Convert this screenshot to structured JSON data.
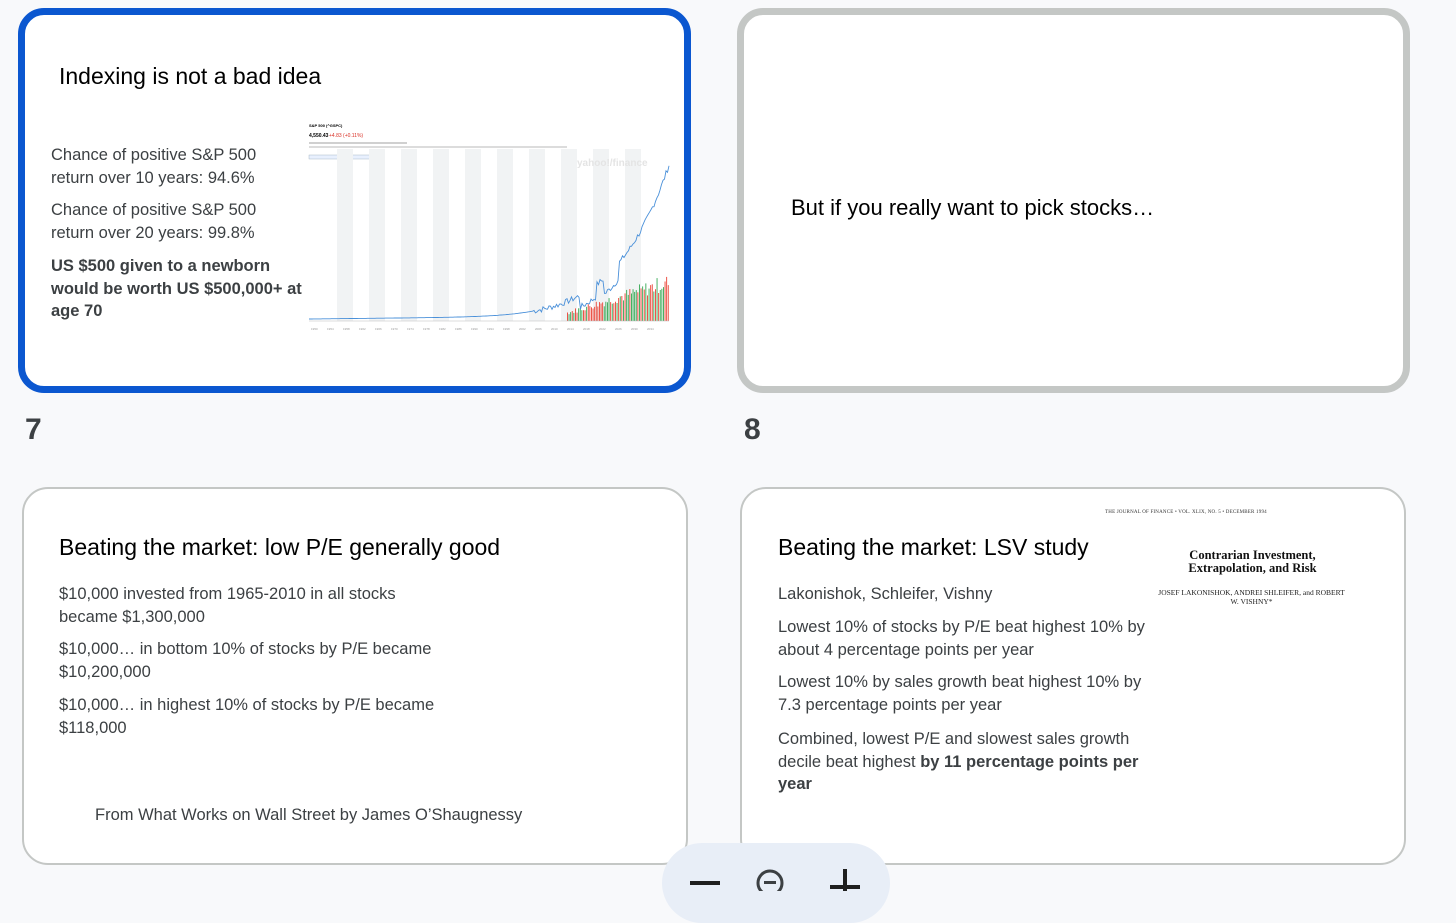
{
  "slides": [
    {
      "number": "",
      "state": "selected",
      "title": "Indexing is not a bad idea",
      "bullets": [
        "Chance of positive S&P 500 return over 10 years: 94.6%",
        "Chance of positive S&P 500 return over 20 years: 99.8%",
        "US $500 given to a newborn would be worth US $500,000+ at age 70"
      ],
      "chart_image": {
        "ticker": "S&P 500 (^GSPC)",
        "price": "4,550.43",
        "change": "+4.83 (+0.11%)",
        "watermark": "yahoo!/finance"
      }
    },
    {
      "number": "",
      "state": "hovered",
      "title": "But if you really want to pick stocks…"
    },
    {
      "number": "7",
      "title": "Beating the market: low P/E generally good",
      "bullets": [
        "$10,000 invested from 1965-2010 in all stocks became $1,300,000",
        "$10,000…  in bottom 10% of stocks by P/E became $10,200,000",
        "$10,000… in highest 10% of stocks by P/E became $118,000"
      ],
      "footer": "From What Works on Wall Street by James O’Shaugnessy"
    },
    {
      "number": "8",
      "title": "Beating the market: LSV study",
      "bullets": [
        "Lakonishok, Schleifer, Vishny",
        "Lowest 10% of stocks by P/E beat highest 10% by about 4 percentage points per year",
        "Lowest 10% by sales growth beat highest 10% by 7.3 percentage points per year"
      ],
      "last_bullet_plain": "Combined, lowest P/E and slowest sales growth decile beat highest ",
      "last_bullet_bold": "by 11 percentage points per year",
      "paper": {
        "journal_header": "THE JOURNAL OF FINANCE • VOL. XLIX, NO. 5 • DECEMBER 1994",
        "title": "Contrarian Investment, Extrapolation, and Risk",
        "authors": "JOSEF LAKONISHOK, ANDREI SHLEIFER, and ROBERT W. VISHNY*"
      }
    }
  ],
  "zoom_controls": {
    "zoom_out_icon": "minus-icon",
    "reset_icon": "zoom-reset-icon",
    "zoom_in_icon": "plus-icon"
  },
  "colors": {
    "selected_border": "#0b57d0",
    "hover_border": "#c4c7c5",
    "chart_line": "#4a90d9",
    "volume_green": "#34a853",
    "volume_red": "#ea4335"
  }
}
